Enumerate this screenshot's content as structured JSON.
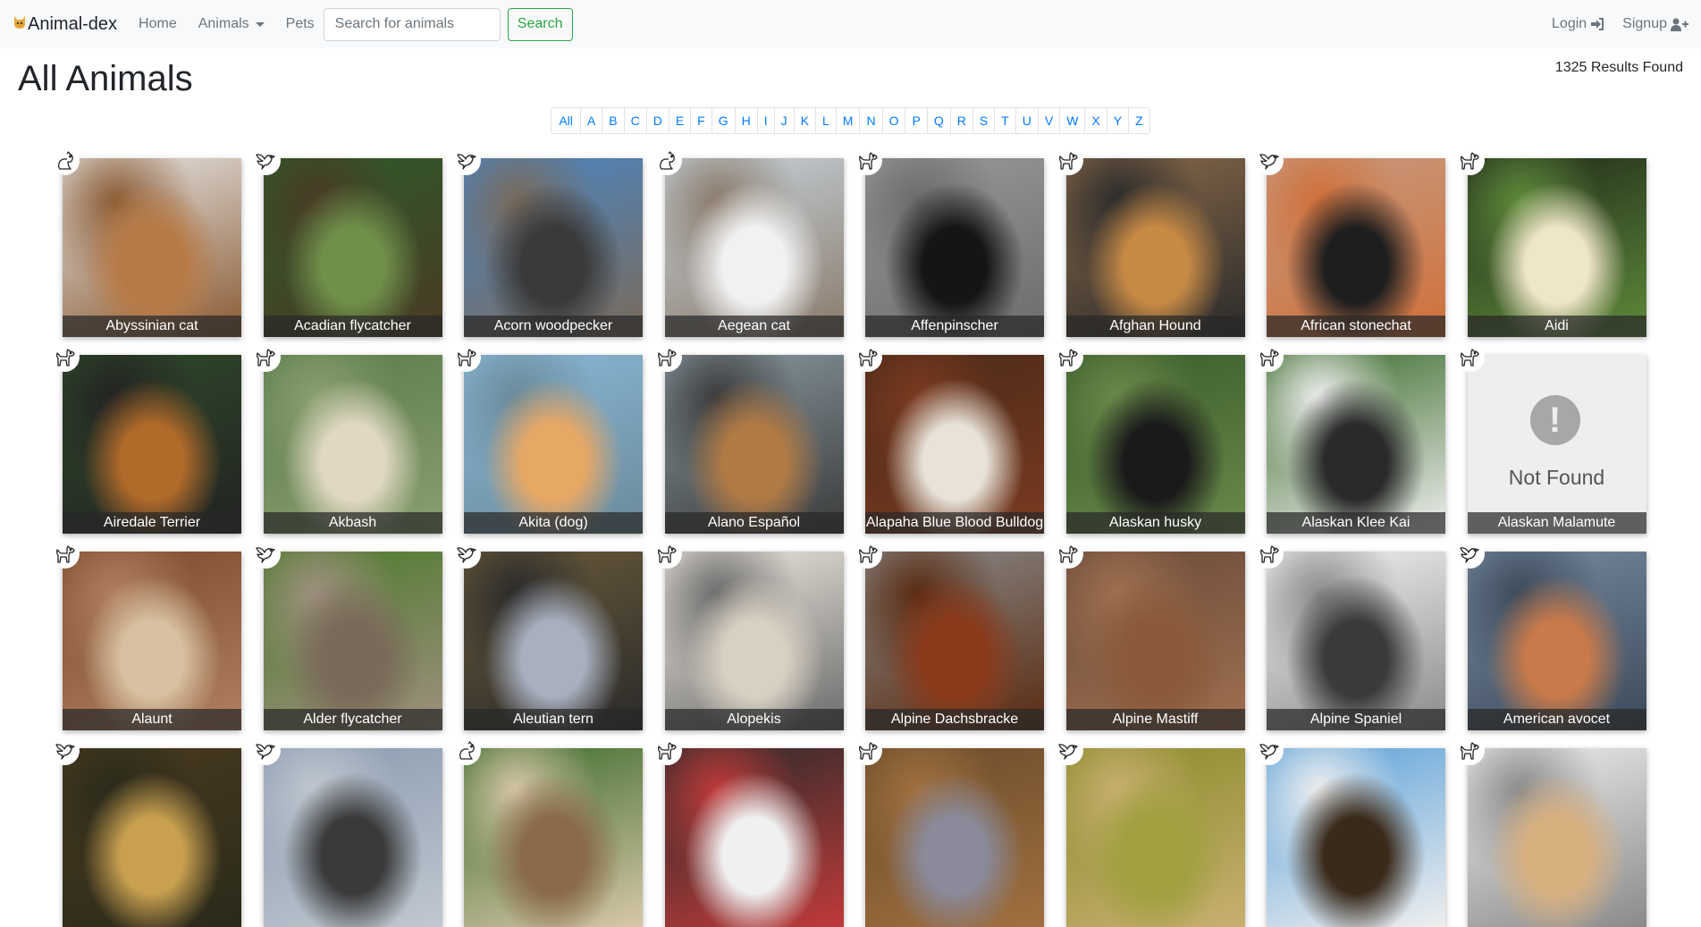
{
  "navbar": {
    "brand": "Animal-dex",
    "brand_icon": "cat-face-icon",
    "home": "Home",
    "animals": "Animals",
    "pets": "Pets",
    "search_placeholder": "Search for animals",
    "search_button": "Search",
    "login": "Login",
    "signup": "Signup"
  },
  "page": {
    "title": "All Animals",
    "results": "1325 Results Found"
  },
  "alphabet": [
    "All",
    "A",
    "B",
    "C",
    "D",
    "E",
    "F",
    "G",
    "H",
    "I",
    "J",
    "K",
    "L",
    "M",
    "N",
    "O",
    "P",
    "Q",
    "R",
    "S",
    "T",
    "U",
    "V",
    "W",
    "X",
    "Y",
    "Z"
  ],
  "not_found_text": "Not Found",
  "animals": [
    {
      "name": "Abyssinian cat",
      "type": "cat",
      "colors": [
        "#e8e8e8",
        "#b87a45",
        "#8a5a32"
      ]
    },
    {
      "name": "Acadian flycatcher",
      "type": "bird",
      "colors": [
        "#2e5a2a",
        "#6f8f4a",
        "#4a3a25"
      ]
    },
    {
      "name": "Acorn woodpecker",
      "type": "bird",
      "colors": [
        "#4a86c4",
        "#3a3a3a",
        "#7a6a5a"
      ]
    },
    {
      "name": "Aegean cat",
      "type": "cat",
      "colors": [
        "#c7d3dc",
        "#f1f1f1",
        "#8a7a6a"
      ]
    },
    {
      "name": "Affenpinscher",
      "type": "dog",
      "colors": [
        "#9a9a9a",
        "#151515",
        "#6b6b6b"
      ]
    },
    {
      "name": "Afghan Hound",
      "type": "dog",
      "colors": [
        "#8a6a4a",
        "#c78a45",
        "#2a2a2a"
      ]
    },
    {
      "name": "African stonechat",
      "type": "bird",
      "colors": [
        "#c79a80",
        "#1e1e1e",
        "#d0703a"
      ]
    },
    {
      "name": "Aidi",
      "type": "dog",
      "colors": [
        "#1f2a1a",
        "#efe5c8",
        "#5f8a3a"
      ]
    },
    {
      "name": "Airedale Terrier",
      "type": "dog",
      "colors": [
        "#2f4a2a",
        "#b06a2a",
        "#222222"
      ]
    },
    {
      "name": "Akbash",
      "type": "dog",
      "colors": [
        "#5a7a4a",
        "#e0d8c3",
        "#8aa070"
      ]
    },
    {
      "name": "Akita (dog)",
      "type": "dog",
      "colors": [
        "#8ab8d8",
        "#e8a865",
        "#6a8a9a"
      ]
    },
    {
      "name": "Alano Español",
      "type": "dog",
      "colors": [
        "#8a9aa2",
        "#b07a45",
        "#3a3a3a"
      ]
    },
    {
      "name": "Alapaha Blue Blood Bulldog",
      "type": "dog",
      "colors": [
        "#4a2a18",
        "#e8e2d8",
        "#7a3a20"
      ]
    },
    {
      "name": "Alaskan husky",
      "type": "dog",
      "colors": [
        "#3a5a2a",
        "#1a1a1a",
        "#6a8a4a"
      ]
    },
    {
      "name": "Alaskan Klee Kai",
      "type": "dog",
      "colors": [
        "#3a6a2a",
        "#2a2a2a",
        "#efefef"
      ]
    },
    {
      "name": "Alaskan Malamute",
      "type": "dog",
      "colors": [],
      "not_found": true
    },
    {
      "name": "Alaunt",
      "type": "dog",
      "colors": [
        "#7a4a2a",
        "#d8c0a0",
        "#b08060"
      ]
    },
    {
      "name": "Alder flycatcher",
      "type": "bird",
      "colors": [
        "#4a7a2a",
        "#7a6a5a",
        "#a09080"
      ]
    },
    {
      "name": "Aleutian tern",
      "type": "bird",
      "colors": [
        "#6a5a3a",
        "#a8b0c0",
        "#2a2a2a"
      ]
    },
    {
      "name": "Alopekis",
      "type": "dog",
      "colors": [
        "#f0ebe2",
        "#d8d0c2",
        "#6a6a6a"
      ]
    },
    {
      "name": "Alpine Dachsbracke",
      "type": "dog",
      "colors": [
        "#8a8a8a",
        "#8a3a1a",
        "#5a2a10"
      ]
    },
    {
      "name": "Alpine Mastiff",
      "type": "dog",
      "colors": [
        "#6a4a3a",
        "#8a5a3a",
        "#a07050"
      ]
    },
    {
      "name": "Alpine Spaniel",
      "type": "dog",
      "colors": [
        "#f5f5f5",
        "#3a3a3a",
        "#8a8a8a"
      ]
    },
    {
      "name": "American avocet",
      "type": "bird",
      "colors": [
        "#7a8aa0",
        "#c87a4a",
        "#3a4a5a"
      ]
    },
    {
      "name": "",
      "type": "bird",
      "colors": [
        "#4a3a20",
        "#c8a050",
        "#2a2a1a"
      ]
    },
    {
      "name": "",
      "type": "bird",
      "colors": [
        "#8a9ab0",
        "#3a3a3a",
        "#c0c8d0"
      ]
    },
    {
      "name": "",
      "type": "cat",
      "colors": [
        "#3a6a2a",
        "#8a6a4a",
        "#d8c8a8"
      ]
    },
    {
      "name": "",
      "type": "dog",
      "colors": [
        "#2a2a2a",
        "#f0f0f0",
        "#c03a3a"
      ]
    },
    {
      "name": "",
      "type": "dog",
      "colors": [
        "#6a4a2a",
        "#8a8a9a",
        "#a07040"
      ]
    },
    {
      "name": "",
      "type": "bird",
      "colors": [
        "#8a8a2a",
        "#a0a040",
        "#c8b070"
      ]
    },
    {
      "name": "",
      "type": "bird",
      "colors": [
        "#5aa0d8",
        "#3a2a1a",
        "#efefef"
      ]
    },
    {
      "name": "",
      "type": "dog",
      "colors": [
        "#f0f0f0",
        "#d8b080",
        "#8a8a8a"
      ]
    }
  ]
}
